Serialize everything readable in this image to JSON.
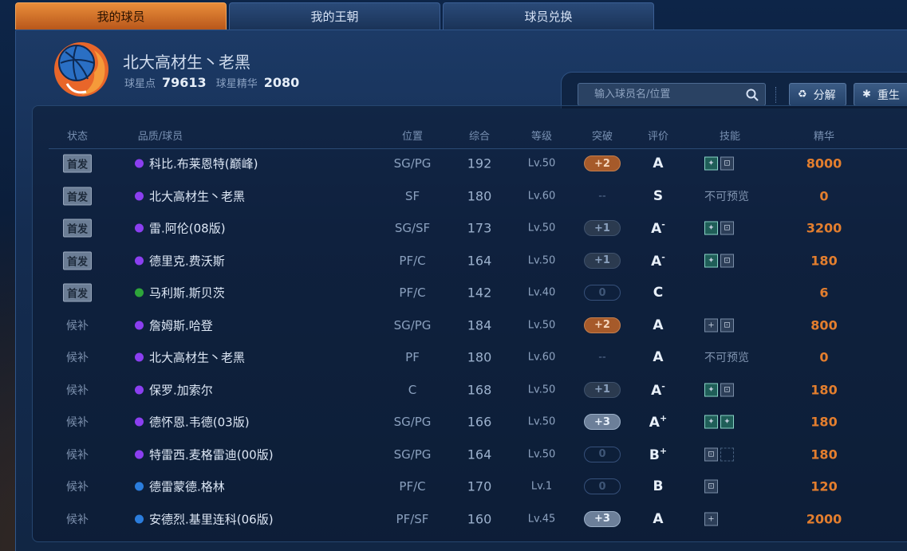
{
  "tabs": [
    {
      "label": "我的球员",
      "active": true
    },
    {
      "label": "我的王朝",
      "active": false
    },
    {
      "label": "球员兑换",
      "active": false
    }
  ],
  "profile": {
    "name": "北大高材生丶老黑",
    "points_label": "球星点",
    "points": "79613",
    "essence_label": "球星精华",
    "essence": "2080"
  },
  "search": {
    "placeholder": "输入球员名/位置"
  },
  "buttons": {
    "decompose": "分解",
    "rebirth": "重生"
  },
  "columns": {
    "status": "状态",
    "player": "品质/球员",
    "position": "位置",
    "overall": "综合",
    "level": "等级",
    "breakthrough": "突破",
    "grade": "评价",
    "skills": "技能",
    "essence": "精华"
  },
  "colors": {
    "purple": "#8b3ff0",
    "green": "#2ea53a",
    "blue": "#2b7ddc",
    "brk_orange": "#a65a2a",
    "brk_dark": "#2b3a4f",
    "brk_light": "#6c7f99",
    "essence": "#e37e2e"
  },
  "rows": [
    {
      "status": "首发",
      "starter": true,
      "quality": "purple",
      "name": "科比.布莱恩特(巅峰)",
      "pos": "SG/PG",
      "ovr": "192",
      "lvl": "Lv.50",
      "brk": "+2",
      "brk_style": "orange",
      "grade": "A",
      "grade_sup": "",
      "skills": [
        "img",
        "lock"
      ],
      "preview": "",
      "ess": "8000"
    },
    {
      "status": "首发",
      "starter": true,
      "quality": "purple",
      "name": "北大高材生丶老黑",
      "pos": "SF",
      "ovr": "180",
      "lvl": "Lv.60",
      "brk": "--",
      "brk_style": "none",
      "grade": "S",
      "grade_sup": "",
      "skills": [],
      "preview": "不可预览",
      "ess": "0"
    },
    {
      "status": "首发",
      "starter": true,
      "quality": "purple",
      "name": "雷.阿伦(08版)",
      "pos": "SG/SF",
      "ovr": "173",
      "lvl": "Lv.50",
      "brk": "+1",
      "brk_style": "dark",
      "grade": "A",
      "grade_sup": "-",
      "skills": [
        "img",
        "lock"
      ],
      "preview": "",
      "ess": "3200"
    },
    {
      "status": "首发",
      "starter": true,
      "quality": "purple",
      "name": "德里克.费沃斯",
      "pos": "PF/C",
      "ovr": "164",
      "lvl": "Lv.50",
      "brk": "+1",
      "brk_style": "dark",
      "grade": "A",
      "grade_sup": "-",
      "skills": [
        "img",
        "lock"
      ],
      "preview": "",
      "ess": "180"
    },
    {
      "status": "首发",
      "starter": true,
      "quality": "green",
      "name": "马利斯.斯贝茨",
      "pos": "PF/C",
      "ovr": "142",
      "lvl": "Lv.40",
      "brk": "0",
      "brk_style": "outline",
      "grade": "C",
      "grade_sup": "",
      "skills": [],
      "preview": "",
      "ess": "6"
    },
    {
      "status": "候补",
      "starter": false,
      "quality": "purple",
      "name": "詹姆斯.哈登",
      "pos": "SG/PG",
      "ovr": "184",
      "lvl": "Lv.50",
      "brk": "+2",
      "brk_style": "orange",
      "grade": "A",
      "grade_sup": "",
      "skills": [
        "plus",
        "lock"
      ],
      "preview": "",
      "ess": "800"
    },
    {
      "status": "候补",
      "starter": false,
      "quality": "purple",
      "name": "北大高材生丶老黑",
      "pos": "PF",
      "ovr": "180",
      "lvl": "Lv.60",
      "brk": "--",
      "brk_style": "none",
      "grade": "A",
      "grade_sup": "",
      "skills": [],
      "preview": "不可预览",
      "ess": "0"
    },
    {
      "status": "候补",
      "starter": false,
      "quality": "purple",
      "name": "保罗.加索尔",
      "pos": "C",
      "ovr": "168",
      "lvl": "Lv.50",
      "brk": "+1",
      "brk_style": "dark",
      "grade": "A",
      "grade_sup": "-",
      "skills": [
        "img",
        "lock"
      ],
      "preview": "",
      "ess": "180"
    },
    {
      "status": "候补",
      "starter": false,
      "quality": "purple",
      "name": "德怀恩.韦德(03版)",
      "pos": "SG/PG",
      "ovr": "166",
      "lvl": "Lv.50",
      "brk": "+3",
      "brk_style": "light",
      "grade": "A",
      "grade_sup": "+",
      "skills": [
        "img",
        "img"
      ],
      "preview": "",
      "ess": "180"
    },
    {
      "status": "候补",
      "starter": false,
      "quality": "purple",
      "name": "特雷西.麦格雷迪(00版)",
      "pos": "SG/PG",
      "ovr": "164",
      "lvl": "Lv.50",
      "brk": "0",
      "brk_style": "outline",
      "grade": "B",
      "grade_sup": "+",
      "skills": [
        "lock",
        "empty"
      ],
      "preview": "",
      "ess": "180"
    },
    {
      "status": "候补",
      "starter": false,
      "quality": "blue",
      "name": "德雷蒙德.格林",
      "pos": "PF/C",
      "ovr": "170",
      "lvl": "Lv.1",
      "brk": "0",
      "brk_style": "outline",
      "grade": "B",
      "grade_sup": "",
      "skills": [
        "lock"
      ],
      "preview": "",
      "ess": "120"
    },
    {
      "status": "候补",
      "starter": false,
      "quality": "blue",
      "name": "安德烈.基里连科(06版)",
      "pos": "PF/SF",
      "ovr": "160",
      "lvl": "Lv.45",
      "brk": "+3",
      "brk_style": "light",
      "grade": "A",
      "grade_sup": "",
      "skills": [
        "plus"
      ],
      "preview": "",
      "ess": "2000"
    }
  ]
}
